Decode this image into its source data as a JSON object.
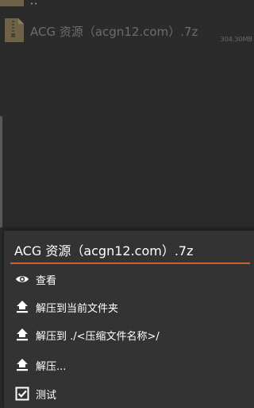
{
  "background_list": {
    "file": {
      "name": "ACG 资源（acgn12.com）.7z",
      "size": "304.30MB",
      "icon": "archive-file-icon"
    }
  },
  "sheet": {
    "title": "ACG 资源（acgn12.com）.7z",
    "accent_color": "#c4622a",
    "items": [
      {
        "label": "查看",
        "icon": "eye-icon"
      },
      {
        "label": "解压到当前文件夹",
        "icon": "upload-icon"
      },
      {
        "label": "解压到 ./<压缩文件名称>/",
        "icon": "upload-icon"
      },
      {
        "label": "解压...",
        "icon": "upload-icon"
      },
      {
        "label": "测试",
        "icon": "checkbox-icon"
      }
    ]
  }
}
